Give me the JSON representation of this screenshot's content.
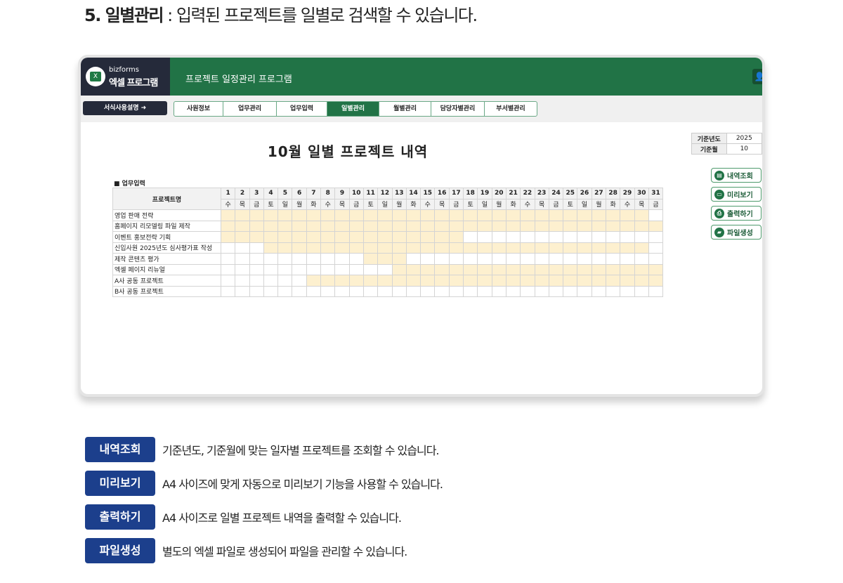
{
  "heading": {
    "number": "5. 일별관리",
    "text": " : 입력된 프로젝트를 일별로 검색할 수 있습니다."
  },
  "logo": {
    "brand": "bizforms",
    "name": "엑셀 프로그램"
  },
  "app_title": "프로젝트 일정관리 프로그램",
  "guide_button": "서식사용설명 ➜",
  "tabs": [
    {
      "label": "사원정보"
    },
    {
      "label": "업무관리"
    },
    {
      "label": "업무입력"
    },
    {
      "label": "일별관리",
      "active": true
    },
    {
      "label": "월별관리"
    },
    {
      "label": "담당자별관리"
    },
    {
      "label": "부서별관리"
    }
  ],
  "report_title": "10월 일별 프로젝트 내역",
  "reference": {
    "year_label": "기준년도",
    "year": "2025",
    "month_label": "기준월",
    "month": "10"
  },
  "actions": [
    "내역조회",
    "미리보기",
    "출력하기",
    "파일생성"
  ],
  "section_label": "■ 업무입력",
  "grid": {
    "name_header": "프로젝트명",
    "days": [
      "1",
      "2",
      "3",
      "4",
      "5",
      "6",
      "7",
      "8",
      "9",
      "10",
      "11",
      "12",
      "13",
      "14",
      "15",
      "16",
      "17",
      "18",
      "19",
      "20",
      "21",
      "22",
      "23",
      "24",
      "25",
      "26",
      "27",
      "28",
      "29",
      "30",
      "31"
    ],
    "weekdays": [
      "수",
      "목",
      "금",
      "토",
      "일",
      "월",
      "화",
      "수",
      "목",
      "금",
      "토",
      "일",
      "월",
      "화",
      "수",
      "목",
      "금",
      "토",
      "일",
      "월",
      "화",
      "수",
      "목",
      "금",
      "토",
      "일",
      "월",
      "화",
      "수",
      "목",
      "금"
    ],
    "projects": [
      {
        "name": "영업 판매 전략",
        "start": 1,
        "end": 30
      },
      {
        "name": "홈페이지 리모델링 파일 제작",
        "start": 1,
        "end": 31
      },
      {
        "name": "이벤트 홍보전략 기획",
        "start": 1,
        "end": 17
      },
      {
        "name": "신입사원 2025년도 심사평가표 작성",
        "start": 4,
        "end": 30
      },
      {
        "name": "제작 콘텐츠 평가",
        "start": 11,
        "end": 13
      },
      {
        "name": "엑셀 페이지 리뉴얼",
        "start": 13,
        "end": 31
      },
      {
        "name": "A사 공동 프로젝트",
        "start": 7,
        "end": 31
      },
      {
        "name": "B사 공동 프로젝트",
        "start": null,
        "end": null
      }
    ]
  },
  "legend": [
    {
      "badge": "내역조회",
      "text": "기준년도, 기준월에 맞는 일자별 프로젝트를 조회할 수 있습니다."
    },
    {
      "badge": "미리보기",
      "text": "A4 사이즈에 맞게 자동으로 미리보기 기능을 사용할 수 있습니다."
    },
    {
      "badge": "출력하기",
      "text": "A4 사이즈로 일별 프로젝트 내역을 출력할 수 있습니다."
    },
    {
      "badge": "파일생성",
      "text": "별도의 엑셀 파일로 생성되어 파일을 관리할 수 있습니다."
    }
  ],
  "colors": {
    "green": "#217346",
    "navy": "#252a3a",
    "fill": "#fdf0cf",
    "badge": "#1c3f8c"
  }
}
